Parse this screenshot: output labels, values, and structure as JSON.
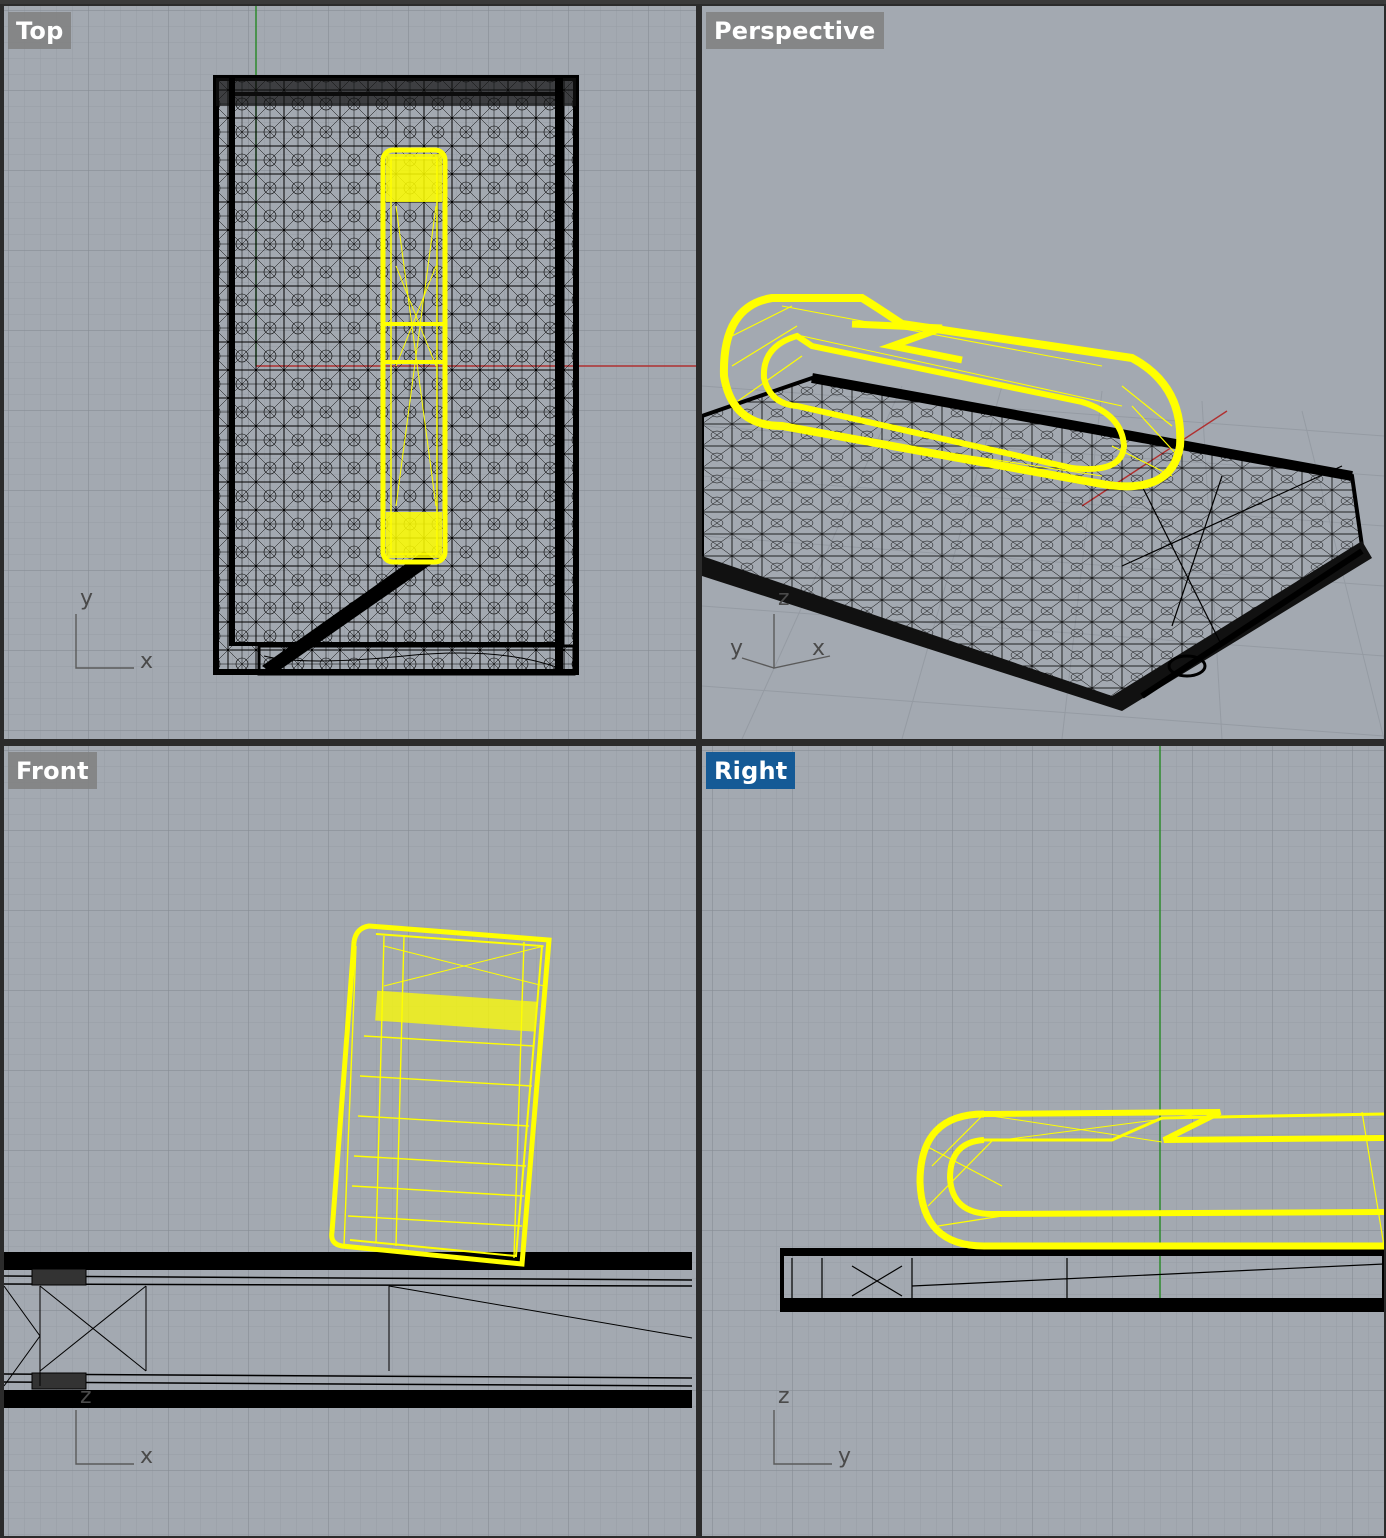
{
  "viewports": {
    "top": {
      "label": "Top",
      "active": false
    },
    "perspective": {
      "label": "Perspective",
      "active": false
    },
    "front": {
      "label": "Front",
      "active": false
    },
    "right": {
      "label": "Right",
      "active": true
    }
  },
  "axis_labels": {
    "top": [
      "y",
      "x"
    ],
    "perspective": [
      "z",
      "y",
      "x"
    ],
    "front": [
      "z",
      "x"
    ],
    "right": [
      "z",
      "y"
    ]
  },
  "colors": {
    "viewport_bg": "#a3a9b1",
    "grid_minor": "#9aa0a8",
    "grid_major": "#8b9199",
    "selection": "#ffff00",
    "wire": "#000000",
    "active_label": "#155a96",
    "axis_x": "#b03030",
    "axis_y": "#2e8a2e"
  }
}
